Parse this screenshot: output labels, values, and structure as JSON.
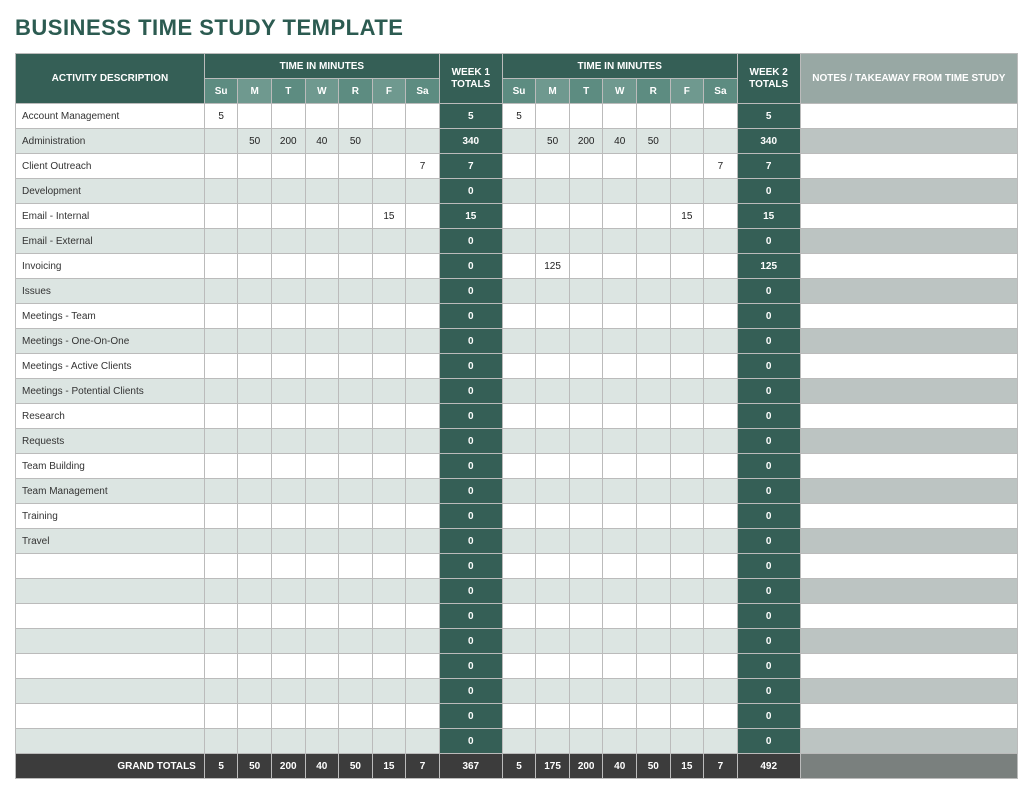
{
  "title": "BUSINESS TIME STUDY TEMPLATE",
  "headers": {
    "activity": "ACTIVITY DESCRIPTION",
    "time_in_minutes": "TIME IN MINUTES",
    "week1_totals": "WEEK 1 TOTALS",
    "week2_totals": "WEEK 2 TOTALS",
    "notes": "NOTES / TAKEAWAY FROM TIME STUDY",
    "days": [
      "Su",
      "M",
      "T",
      "W",
      "R",
      "F",
      "Sa"
    ]
  },
  "rows": [
    {
      "activity": "Account Management",
      "w1": [
        "5",
        "",
        "",
        "",
        "",
        "",
        ""
      ],
      "t1": "5",
      "w2": [
        "5",
        "",
        "",
        "",
        "",
        "",
        ""
      ],
      "t2": "5",
      "notes": ""
    },
    {
      "activity": "Administration",
      "w1": [
        "",
        "50",
        "200",
        "40",
        "50",
        "",
        ""
      ],
      "t1": "340",
      "w2": [
        "",
        "50",
        "200",
        "40",
        "50",
        "",
        ""
      ],
      "t2": "340",
      "notes": ""
    },
    {
      "activity": "Client Outreach",
      "w1": [
        "",
        "",
        "",
        "",
        "",
        "",
        "7"
      ],
      "t1": "7",
      "w2": [
        "",
        "",
        "",
        "",
        "",
        "",
        "7"
      ],
      "t2": "7",
      "notes": ""
    },
    {
      "activity": "Development",
      "w1": [
        "",
        "",
        "",
        "",
        "",
        "",
        ""
      ],
      "t1": "0",
      "w2": [
        "",
        "",
        "",
        "",
        "",
        "",
        ""
      ],
      "t2": "0",
      "notes": ""
    },
    {
      "activity": "Email - Internal",
      "w1": [
        "",
        "",
        "",
        "",
        "",
        "15",
        ""
      ],
      "t1": "15",
      "w2": [
        "",
        "",
        "",
        "",
        "",
        "15",
        ""
      ],
      "t2": "15",
      "notes": ""
    },
    {
      "activity": "Email - External",
      "w1": [
        "",
        "",
        "",
        "",
        "",
        "",
        ""
      ],
      "t1": "0",
      "w2": [
        "",
        "",
        "",
        "",
        "",
        "",
        ""
      ],
      "t2": "0",
      "notes": ""
    },
    {
      "activity": "Invoicing",
      "w1": [
        "",
        "",
        "",
        "",
        "",
        "",
        ""
      ],
      "t1": "0",
      "w2": [
        "",
        "125",
        "",
        "",
        "",
        "",
        ""
      ],
      "t2": "125",
      "notes": ""
    },
    {
      "activity": "Issues",
      "w1": [
        "",
        "",
        "",
        "",
        "",
        "",
        ""
      ],
      "t1": "0",
      "w2": [
        "",
        "",
        "",
        "",
        "",
        "",
        ""
      ],
      "t2": "0",
      "notes": ""
    },
    {
      "activity": "Meetings - Team",
      "w1": [
        "",
        "",
        "",
        "",
        "",
        "",
        ""
      ],
      "t1": "0",
      "w2": [
        "",
        "",
        "",
        "",
        "",
        "",
        ""
      ],
      "t2": "0",
      "notes": ""
    },
    {
      "activity": "Meetings - One-On-One",
      "w1": [
        "",
        "",
        "",
        "",
        "",
        "",
        ""
      ],
      "t1": "0",
      "w2": [
        "",
        "",
        "",
        "",
        "",
        "",
        ""
      ],
      "t2": "0",
      "notes": ""
    },
    {
      "activity": "Meetings - Active Clients",
      "w1": [
        "",
        "",
        "",
        "",
        "",
        "",
        ""
      ],
      "t1": "0",
      "w2": [
        "",
        "",
        "",
        "",
        "",
        "",
        ""
      ],
      "t2": "0",
      "notes": ""
    },
    {
      "activity": "Meetings - Potential Clients",
      "w1": [
        "",
        "",
        "",
        "",
        "",
        "",
        ""
      ],
      "t1": "0",
      "w2": [
        "",
        "",
        "",
        "",
        "",
        "",
        ""
      ],
      "t2": "0",
      "notes": ""
    },
    {
      "activity": "Research",
      "w1": [
        "",
        "",
        "",
        "",
        "",
        "",
        ""
      ],
      "t1": "0",
      "w2": [
        "",
        "",
        "",
        "",
        "",
        "",
        ""
      ],
      "t2": "0",
      "notes": ""
    },
    {
      "activity": "Requests",
      "w1": [
        "",
        "",
        "",
        "",
        "",
        "",
        ""
      ],
      "t1": "0",
      "w2": [
        "",
        "",
        "",
        "",
        "",
        "",
        ""
      ],
      "t2": "0",
      "notes": ""
    },
    {
      "activity": "Team Building",
      "w1": [
        "",
        "",
        "",
        "",
        "",
        "",
        ""
      ],
      "t1": "0",
      "w2": [
        "",
        "",
        "",
        "",
        "",
        "",
        ""
      ],
      "t2": "0",
      "notes": ""
    },
    {
      "activity": "Team Management",
      "w1": [
        "",
        "",
        "",
        "",
        "",
        "",
        ""
      ],
      "t1": "0",
      "w2": [
        "",
        "",
        "",
        "",
        "",
        "",
        ""
      ],
      "t2": "0",
      "notes": ""
    },
    {
      "activity": "Training",
      "w1": [
        "",
        "",
        "",
        "",
        "",
        "",
        ""
      ],
      "t1": "0",
      "w2": [
        "",
        "",
        "",
        "",
        "",
        "",
        ""
      ],
      "t2": "0",
      "notes": ""
    },
    {
      "activity": "Travel",
      "w1": [
        "",
        "",
        "",
        "",
        "",
        "",
        ""
      ],
      "t1": "0",
      "w2": [
        "",
        "",
        "",
        "",
        "",
        "",
        ""
      ],
      "t2": "0",
      "notes": ""
    },
    {
      "activity": "",
      "w1": [
        "",
        "",
        "",
        "",
        "",
        "",
        ""
      ],
      "t1": "0",
      "w2": [
        "",
        "",
        "",
        "",
        "",
        "",
        ""
      ],
      "t2": "0",
      "notes": ""
    },
    {
      "activity": "",
      "w1": [
        "",
        "",
        "",
        "",
        "",
        "",
        ""
      ],
      "t1": "0",
      "w2": [
        "",
        "",
        "",
        "",
        "",
        "",
        ""
      ],
      "t2": "0",
      "notes": ""
    },
    {
      "activity": "",
      "w1": [
        "",
        "",
        "",
        "",
        "",
        "",
        ""
      ],
      "t1": "0",
      "w2": [
        "",
        "",
        "",
        "",
        "",
        "",
        ""
      ],
      "t2": "0",
      "notes": ""
    },
    {
      "activity": "",
      "w1": [
        "",
        "",
        "",
        "",
        "",
        "",
        ""
      ],
      "t1": "0",
      "w2": [
        "",
        "",
        "",
        "",
        "",
        "",
        ""
      ],
      "t2": "0",
      "notes": ""
    },
    {
      "activity": "",
      "w1": [
        "",
        "",
        "",
        "",
        "",
        "",
        ""
      ],
      "t1": "0",
      "w2": [
        "",
        "",
        "",
        "",
        "",
        "",
        ""
      ],
      "t2": "0",
      "notes": ""
    },
    {
      "activity": "",
      "w1": [
        "",
        "",
        "",
        "",
        "",
        "",
        ""
      ],
      "t1": "0",
      "w2": [
        "",
        "",
        "",
        "",
        "",
        "",
        ""
      ],
      "t2": "0",
      "notes": ""
    },
    {
      "activity": "",
      "w1": [
        "",
        "",
        "",
        "",
        "",
        "",
        ""
      ],
      "t1": "0",
      "w2": [
        "",
        "",
        "",
        "",
        "",
        "",
        ""
      ],
      "t2": "0",
      "notes": ""
    },
    {
      "activity": "",
      "w1": [
        "",
        "",
        "",
        "",
        "",
        "",
        ""
      ],
      "t1": "0",
      "w2": [
        "",
        "",
        "",
        "",
        "",
        "",
        ""
      ],
      "t2": "0",
      "notes": ""
    }
  ],
  "grand": {
    "label": "GRAND TOTALS",
    "w1": [
      "5",
      "50",
      "200",
      "40",
      "50",
      "15",
      "7"
    ],
    "t1": "367",
    "w2": [
      "5",
      "175",
      "200",
      "40",
      "50",
      "15",
      "7"
    ],
    "t2": "492",
    "notes": ""
  }
}
